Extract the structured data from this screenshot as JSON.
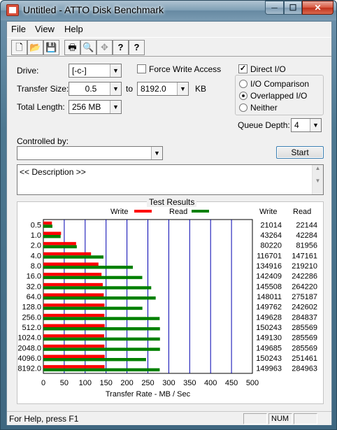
{
  "window": {
    "title": "Untitled - ATTO Disk Benchmark",
    "min": "─",
    "max": "☐",
    "close": "✕"
  },
  "menu": {
    "file": "File",
    "view": "View",
    "help": "Help"
  },
  "toolbar": {
    "new": "🗋",
    "open": "📂",
    "save": "💾",
    "print": "🖶",
    "preview": "🔍",
    "move": "✥",
    "help": "?",
    "context_help": "?"
  },
  "form": {
    "drive_label": "Drive:",
    "drive_value": "[-c-]",
    "force_write_label": "Force Write Access",
    "force_write_checked": false,
    "direct_io_label": "Direct I/O",
    "direct_io_checked": true,
    "transfer_size_label": "Transfer Size:",
    "transfer_from": "0.5",
    "to_label": "to",
    "transfer_to": "8192.0",
    "kb_label": "KB",
    "total_length_label": "Total Length:",
    "total_length_value": "256 MB",
    "io_options": [
      "I/O Comparison",
      "Overlapped I/O",
      "Neither"
    ],
    "io_selected": 1,
    "queue_depth_label": "Queue Depth:",
    "queue_depth_value": "4",
    "controlled_by_label": "Controlled by:",
    "controlled_by_value": "",
    "start_label": "Start",
    "description_text": "<< Description >>"
  },
  "results": {
    "group_title": "Test Results",
    "legend_write": "Write",
    "legend_read": "Read",
    "col_write": "Write",
    "col_read": "Read",
    "write_values": [
      "21014",
      "43264",
      "80220",
      "116701",
      "134916",
      "142409",
      "145508",
      "148011",
      "149762",
      "149628",
      "150243",
      "149130",
      "149685",
      "150243",
      "149963"
    ],
    "read_values": [
      "22144",
      "42284",
      "81956",
      "147161",
      "219210",
      "242286",
      "264220",
      "275187",
      "242602",
      "284837",
      "285569",
      "285569",
      "285569",
      "251461",
      "284963"
    ]
  },
  "chart_data": {
    "type": "bar",
    "orientation": "horizontal",
    "categories": [
      "0.5",
      "1.0",
      "2.0",
      "4.0",
      "8.0",
      "16.0",
      "32.0",
      "64.0",
      "128.0",
      "256.0",
      "512.0",
      "1024.0",
      "2048.0",
      "4096.0",
      "8192.0"
    ],
    "series": [
      {
        "name": "Write",
        "color": "#ff0000",
        "values": [
          20.5,
          42.3,
          78.3,
          114.0,
          131.8,
          139.1,
          142.1,
          144.5,
          146.3,
          146.1,
          146.7,
          145.6,
          146.2,
          146.7,
          146.4
        ]
      },
      {
        "name": "Read",
        "color": "#008000",
        "values": [
          21.6,
          41.3,
          80.0,
          143.7,
          214.1,
          236.6,
          258.0,
          268.7,
          236.9,
          278.2,
          278.9,
          278.9,
          278.9,
          245.6,
          278.3
        ]
      }
    ],
    "xlim": [
      0,
      500
    ],
    "xticks": [
      "0",
      "50",
      "100",
      "150",
      "200",
      "250",
      "300",
      "350",
      "400",
      "450",
      "500"
    ],
    "xlabel": "Transfer Rate - MB / Sec",
    "grid": true,
    "legend": "top"
  },
  "status": {
    "help_text": "For Help, press F1",
    "num": "NUM"
  }
}
